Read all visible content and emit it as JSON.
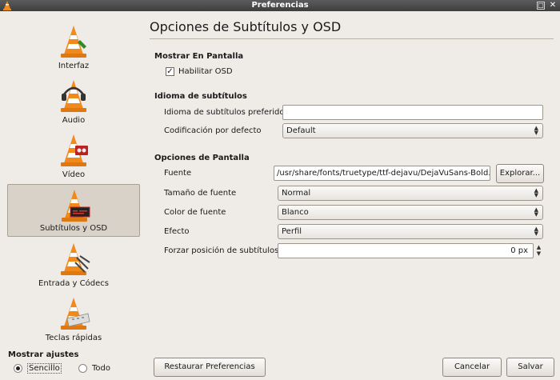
{
  "window": {
    "title": "Preferencias",
    "max_glyph": "□",
    "close_glyph": "✕"
  },
  "sidebar": {
    "items": [
      {
        "label": "Interfaz",
        "icon": "vlc-cone-interface-icon",
        "selected": false
      },
      {
        "label": "Audio",
        "icon": "vlc-cone-headphones-icon",
        "selected": false
      },
      {
        "label": "Vídeo",
        "icon": "vlc-cone-video-icon",
        "selected": false
      },
      {
        "label": "Subtítulos y OSD",
        "icon": "vlc-cone-subtitles-icon",
        "selected": true
      },
      {
        "label": "Entrada y Códecs",
        "icon": "vlc-cone-input-icon",
        "selected": false
      },
      {
        "label": "Teclas rápidas",
        "icon": "vlc-cone-hotkeys-icon",
        "selected": false
      }
    ],
    "show_settings_label": "Mostrar ajustes",
    "simple_label": "Sencillo",
    "all_label": "Todo",
    "mode": "simple"
  },
  "main": {
    "title": "Opciones de Subtítulos y OSD",
    "osd": {
      "section": "Mostrar En Pantalla",
      "enable_label": "Habilitar OSD",
      "enabled": true,
      "check_glyph": "✓"
    },
    "language": {
      "section": "Idioma de subtítulos",
      "preferred_label": "Idioma de subtítulos preferido",
      "preferred_value": "",
      "encoding_label": "Codificación por defecto",
      "encoding_value": "Default"
    },
    "display": {
      "section": "Opciones de Pantalla",
      "font_label": "Fuente",
      "font_value": "/usr/share/fonts/truetype/ttf-dejavu/DejaVuSans-Bold.ttf",
      "browse_label": "Explorar...",
      "size_label": "Tamaño de fuente",
      "size_value": "Normal",
      "color_label": "Color de fuente",
      "color_value": "Blanco",
      "effect_label": "Efecto",
      "effect_value": "Perfil",
      "position_label": "Forzar posición de subtítulos",
      "position_value": "0 px"
    }
  },
  "footer": {
    "reset_label": "Restaurar Preferencias",
    "cancel_label": "Cancelar",
    "save_label": "Salvar"
  },
  "colors": {
    "cone_orange": "#f08a1c",
    "background": "#efebe7",
    "titlebar": "#4a4a4a"
  }
}
